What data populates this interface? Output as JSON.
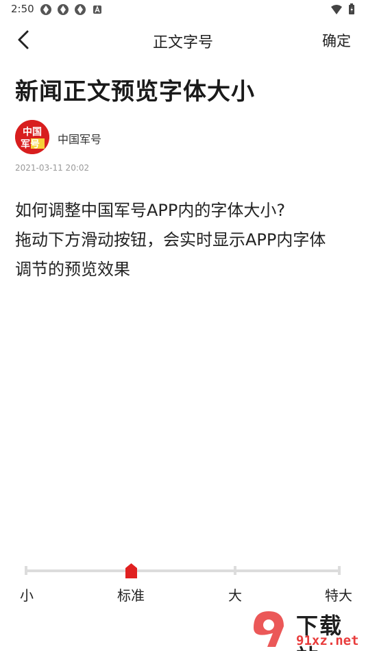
{
  "status_bar": {
    "time": "2:50",
    "left_icons": [
      "app-icon",
      "app-icon",
      "app-icon",
      "a-notification-icon"
    ],
    "right_icons": [
      "wifi-icon",
      "battery-charging-icon"
    ]
  },
  "header": {
    "title": "正文字号",
    "confirm_label": "确定",
    "back_icon": "chevron-left-icon"
  },
  "article": {
    "title": "新闻正文预览字体大小",
    "author_name": "中国军号",
    "avatar_text_line1": "中国",
    "avatar_text_line2": "军号",
    "publish_time": "2021-03-11 20:02",
    "body_lines": [
      "如何调整中国军号APP内的字体大小?",
      "拖动下方滑动按钮，会实时显示APP内字体",
      "调节的预览效果"
    ]
  },
  "font_size_slider": {
    "levels": [
      "小",
      "标准",
      "大",
      "特大"
    ],
    "selected_index": 1,
    "thumb_color": "#e02020"
  },
  "watermark": {
    "title": "下载站",
    "url": "91xz.net",
    "brand_color": "#e83b3b"
  }
}
